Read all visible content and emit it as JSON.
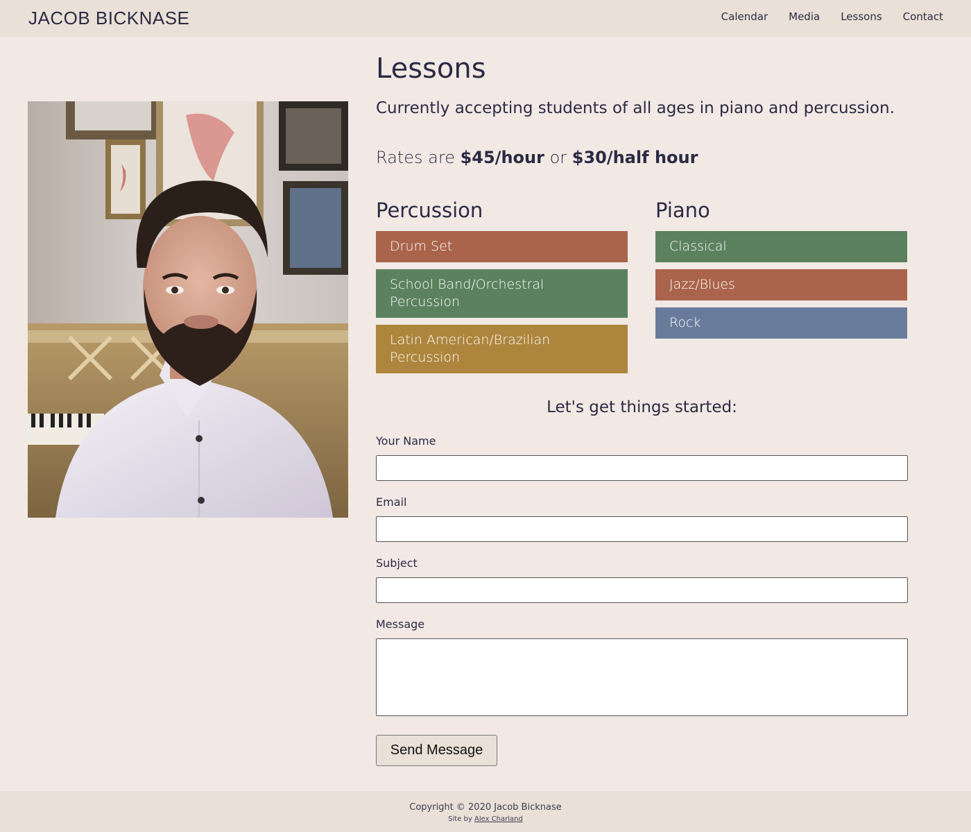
{
  "site": {
    "brand": "JACOB BICKNASE"
  },
  "nav": [
    {
      "label": "Calendar"
    },
    {
      "label": "Media"
    },
    {
      "label": "Lessons"
    },
    {
      "label": "Contact"
    }
  ],
  "main": {
    "title": "Lessons",
    "lead": "Currently accepting students of all ages in piano and percussion.",
    "rates": {
      "prefix": "Rates are ",
      "hour": "$45/hour",
      "or": " or ",
      "half": "$30/half hour"
    }
  },
  "percussion": {
    "heading": "Percussion",
    "items": [
      {
        "label": "Drum Set",
        "color": "#a9644b"
      },
      {
        "label": "School Band/Orchestral Percussion",
        "color": "#5b815e"
      },
      {
        "label": "Latin American/Brazilian Percussion",
        "color": "#ad853d"
      }
    ]
  },
  "piano": {
    "heading": "Piano",
    "items": [
      {
        "label": "Classical",
        "color": "#5b815e"
      },
      {
        "label": "Jazz/Blues",
        "color": "#a9644b"
      },
      {
        "label": "Rock",
        "color": "#697b9b"
      }
    ]
  },
  "form": {
    "title": "Let's get things started:",
    "name_label": "Your Name",
    "email_label": "Email",
    "subject_label": "Subject",
    "message_label": "Message",
    "name_value": "",
    "email_value": "",
    "subject_value": "",
    "message_value": "",
    "submit_label": "Send Message"
  },
  "footer": {
    "copyright": "Copyright © 2020 Jacob Bicknase",
    "credit_prefix": "Site by ",
    "credit_link": "Alex Charland"
  },
  "colors": {
    "background": "#f2e9e4",
    "header": "#e9e0d7",
    "text": "#2b2a44"
  }
}
